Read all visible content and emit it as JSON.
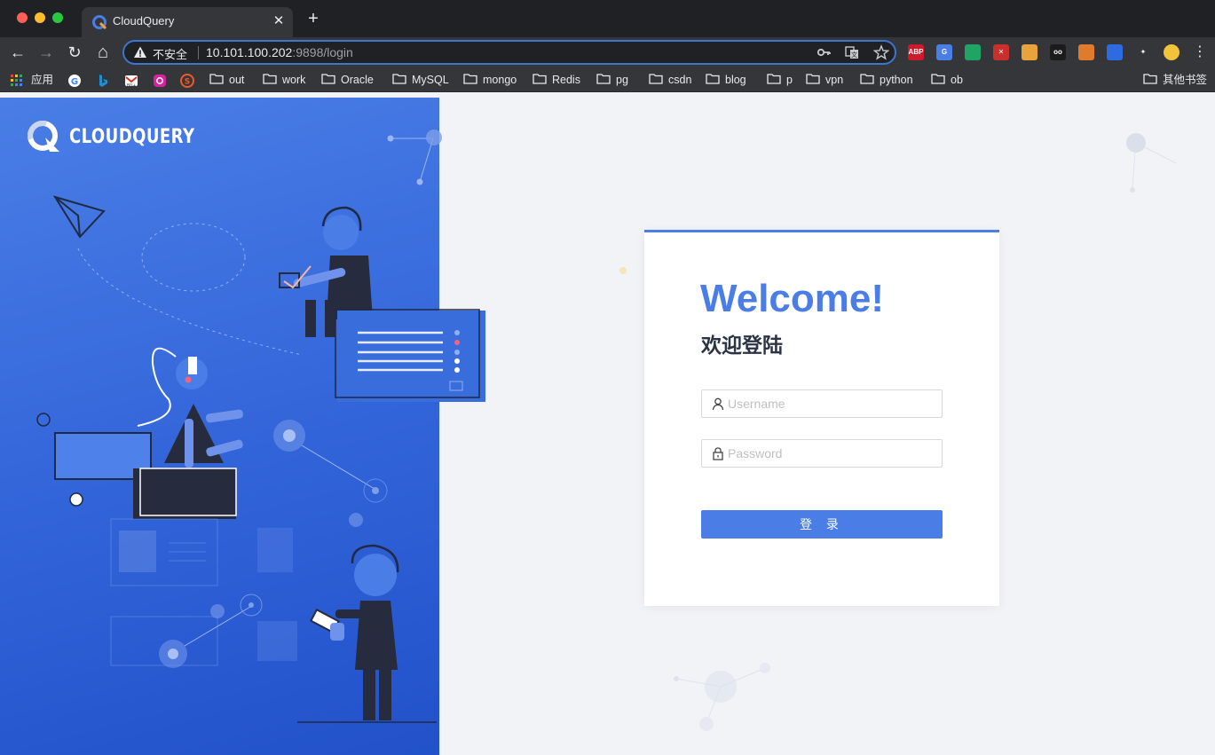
{
  "browser": {
    "tab_title": "CloudQuery",
    "tab_close": "✕",
    "new_tab": "+",
    "nav": {
      "back": "←",
      "forward": "→",
      "reload": "↻",
      "home": "⌂"
    },
    "security_label": "不安全",
    "url_host": "10.101.100.202",
    "url_rest": ":9898/login",
    "omnibox_icons": [
      "key-icon",
      "translate-icon",
      "star-icon"
    ],
    "extensions": [
      {
        "name": "adblock-plus-extension",
        "label": "ABP",
        "color": "#d0192a"
      },
      {
        "name": "google-translate-extension",
        "label": "G",
        "color": "#4a7ee6"
      },
      {
        "name": "google-drive-extension",
        "label": "",
        "color": "#1fa463"
      },
      {
        "name": "x-extension",
        "label": "✕",
        "color": "#c9302c"
      },
      {
        "name": "colorful-extension",
        "label": "",
        "color": "#e8a33a"
      },
      {
        "name": "glasses-extension",
        "label": "oo",
        "color": "#1b1b1b"
      },
      {
        "name": "tiger-extension",
        "label": "",
        "color": "#e07b2c"
      },
      {
        "name": "flag-extension",
        "label": "",
        "color": "#2d6be0"
      },
      {
        "name": "puzzle-extension",
        "label": "✦",
        "color": "#35363a"
      },
      {
        "name": "profile-avatar",
        "label": "",
        "color": "#f3c33b"
      }
    ],
    "menu": "⋮"
  },
  "bookmarks": {
    "apps_label": "应用",
    "folders": [
      "out",
      "work",
      "Oracle",
      "MySQL",
      "mongo",
      "Redis",
      "pg",
      "csdn",
      "blog",
      "p",
      "vpn",
      "python",
      "ob"
    ],
    "other": "其他书签"
  },
  "brand": {
    "logo_text": "CLOUDQUERY"
  },
  "login": {
    "title": "Welcome!",
    "subtitle": "欢迎登陆",
    "username_placeholder": "Username",
    "password_placeholder": "Password",
    "submit_label": "登 录"
  },
  "colors": {
    "accent": "#4a7ee6",
    "panel_dark": "#2251c9",
    "page_bg": "#f2f3f7"
  }
}
